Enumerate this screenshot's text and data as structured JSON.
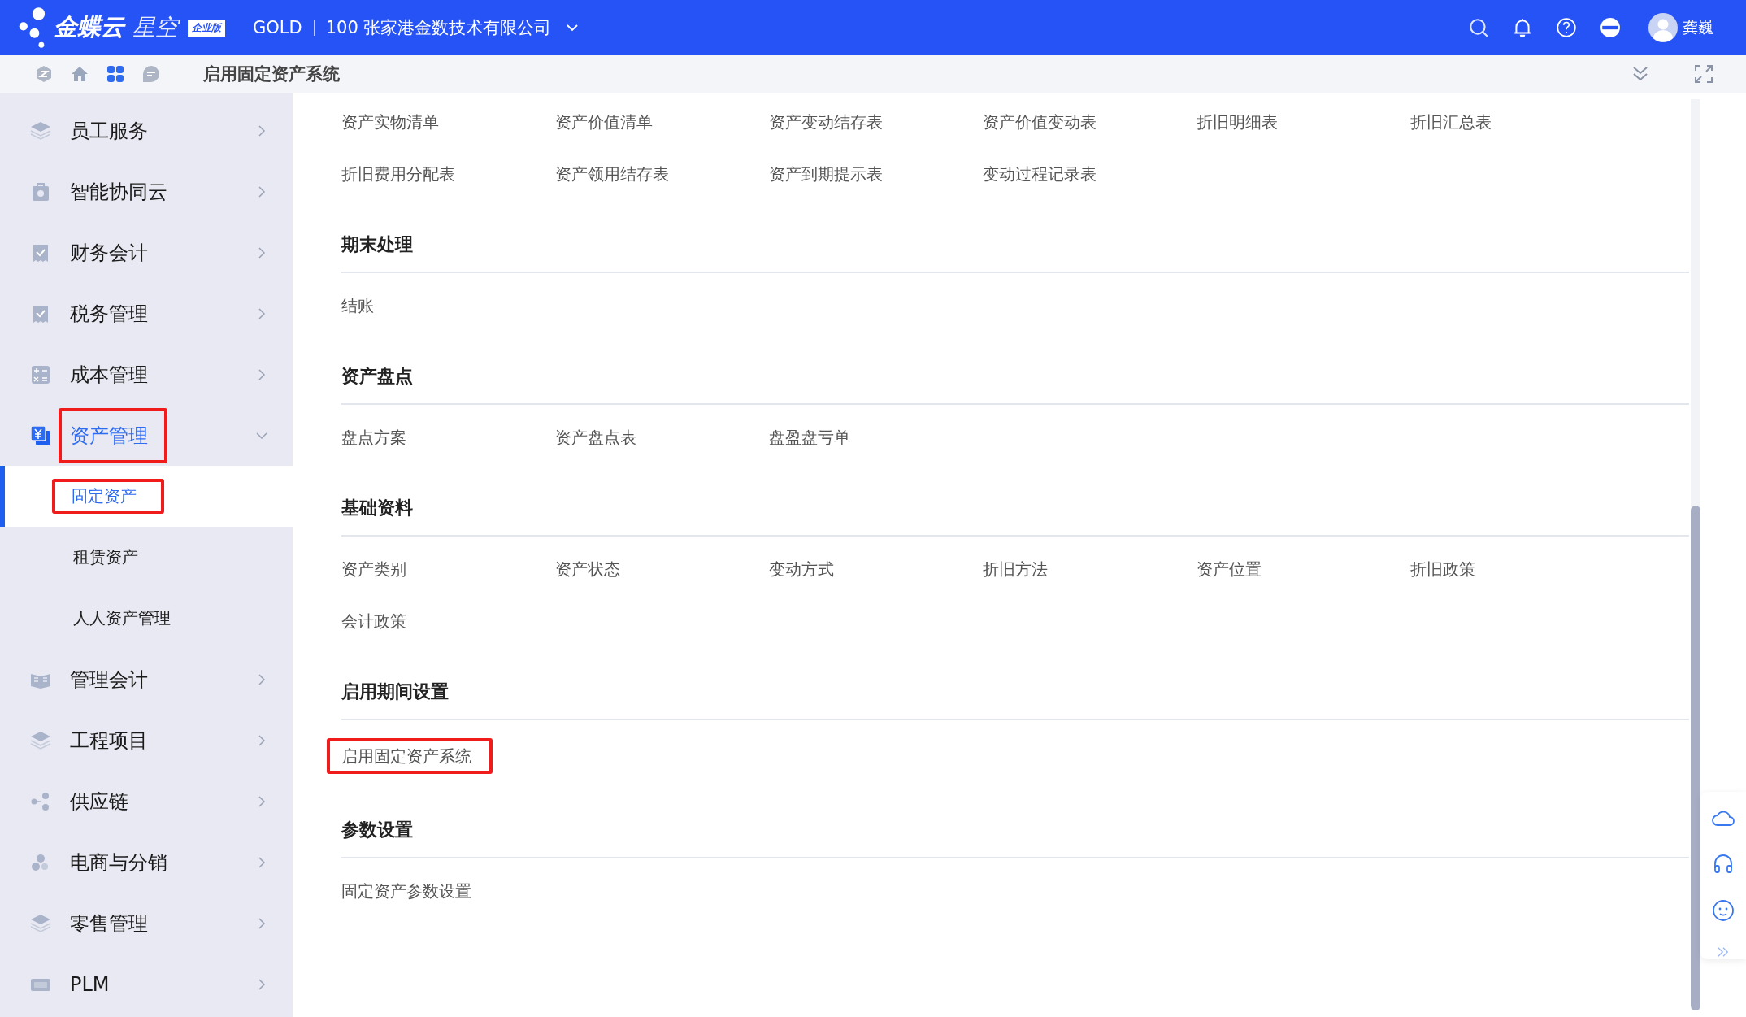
{
  "topbar": {
    "logo_text": "金蝶云",
    "logo_subtext": "星空",
    "edition_badge": "企业版",
    "tenant": "GOLD",
    "company": "100 张家港金数技术有限公司",
    "user_name": "龚巍"
  },
  "subheader": {
    "title": "启用固定资产系统"
  },
  "sidebar": {
    "items": [
      {
        "label": "员工服务",
        "kind": "layers",
        "active": false,
        "expanded": false,
        "highlighted": false
      },
      {
        "label": "智能协同云",
        "kind": "bag",
        "active": false,
        "expanded": false,
        "highlighted": false
      },
      {
        "label": "财务会计",
        "kind": "receipt",
        "active": false,
        "expanded": false,
        "highlighted": false
      },
      {
        "label": "税务管理",
        "kind": "receipt",
        "active": false,
        "expanded": false,
        "highlighted": false
      },
      {
        "label": "成本管理",
        "kind": "calc",
        "active": false,
        "expanded": false,
        "highlighted": false
      },
      {
        "label": "资产管理",
        "kind": "asset",
        "active": true,
        "expanded": true,
        "highlighted": true,
        "children": [
          {
            "label": "固定资产",
            "selected": true,
            "highlighted": true
          },
          {
            "label": "租赁资产",
            "selected": false,
            "highlighted": false
          },
          {
            "label": "人人资产管理",
            "selected": false,
            "highlighted": false
          }
        ]
      },
      {
        "label": "管理会计",
        "kind": "book",
        "active": false,
        "expanded": false,
        "highlighted": false
      },
      {
        "label": "工程项目",
        "kind": "layers",
        "active": false,
        "expanded": false,
        "highlighted": false
      },
      {
        "label": "供应链",
        "kind": "nodes",
        "active": false,
        "expanded": false,
        "highlighted": false
      },
      {
        "label": "电商与分销",
        "kind": "dots",
        "active": false,
        "expanded": false,
        "highlighted": false
      },
      {
        "label": "零售管理",
        "kind": "layers",
        "active": false,
        "expanded": false,
        "highlighted": false
      },
      {
        "label": "PLM",
        "kind": "plm",
        "active": false,
        "expanded": false,
        "highlighted": false
      }
    ]
  },
  "sections": [
    {
      "links": [
        {
          "label": "资产实物清单",
          "highlighted": false
        },
        {
          "label": "资产价值清单",
          "highlighted": false
        },
        {
          "label": "资产变动结存表",
          "highlighted": false
        },
        {
          "label": "资产价值变动表",
          "highlighted": false
        },
        {
          "label": "折旧明细表",
          "highlighted": false
        },
        {
          "label": "折旧汇总表",
          "highlighted": false
        },
        {
          "label": "折旧费用分配表",
          "highlighted": false
        },
        {
          "label": "资产领用结存表",
          "highlighted": false
        },
        {
          "label": "资产到期提示表",
          "highlighted": false
        },
        {
          "label": "变动过程记录表",
          "highlighted": false
        }
      ]
    },
    {
      "title": "期末处理",
      "links": [
        {
          "label": "结账",
          "highlighted": false
        }
      ]
    },
    {
      "title": "资产盘点",
      "links": [
        {
          "label": "盘点方案",
          "highlighted": false
        },
        {
          "label": "资产盘点表",
          "highlighted": false
        },
        {
          "label": "盘盈盘亏单",
          "highlighted": false
        }
      ]
    },
    {
      "title": "基础资料",
      "links": [
        {
          "label": "资产类别",
          "highlighted": false
        },
        {
          "label": "资产状态",
          "highlighted": false
        },
        {
          "label": "变动方式",
          "highlighted": false
        },
        {
          "label": "折旧方法",
          "highlighted": false
        },
        {
          "label": "资产位置",
          "highlighted": false
        },
        {
          "label": "折旧政策",
          "highlighted": false
        },
        {
          "label": "会计政策",
          "highlighted": false
        }
      ]
    },
    {
      "title": "启用期间设置",
      "links": [
        {
          "label": "启用固定资产系统",
          "highlighted": true
        }
      ]
    },
    {
      "title": "参数设置",
      "links": [
        {
          "label": "固定资产参数设置",
          "highlighted": false
        }
      ]
    }
  ]
}
